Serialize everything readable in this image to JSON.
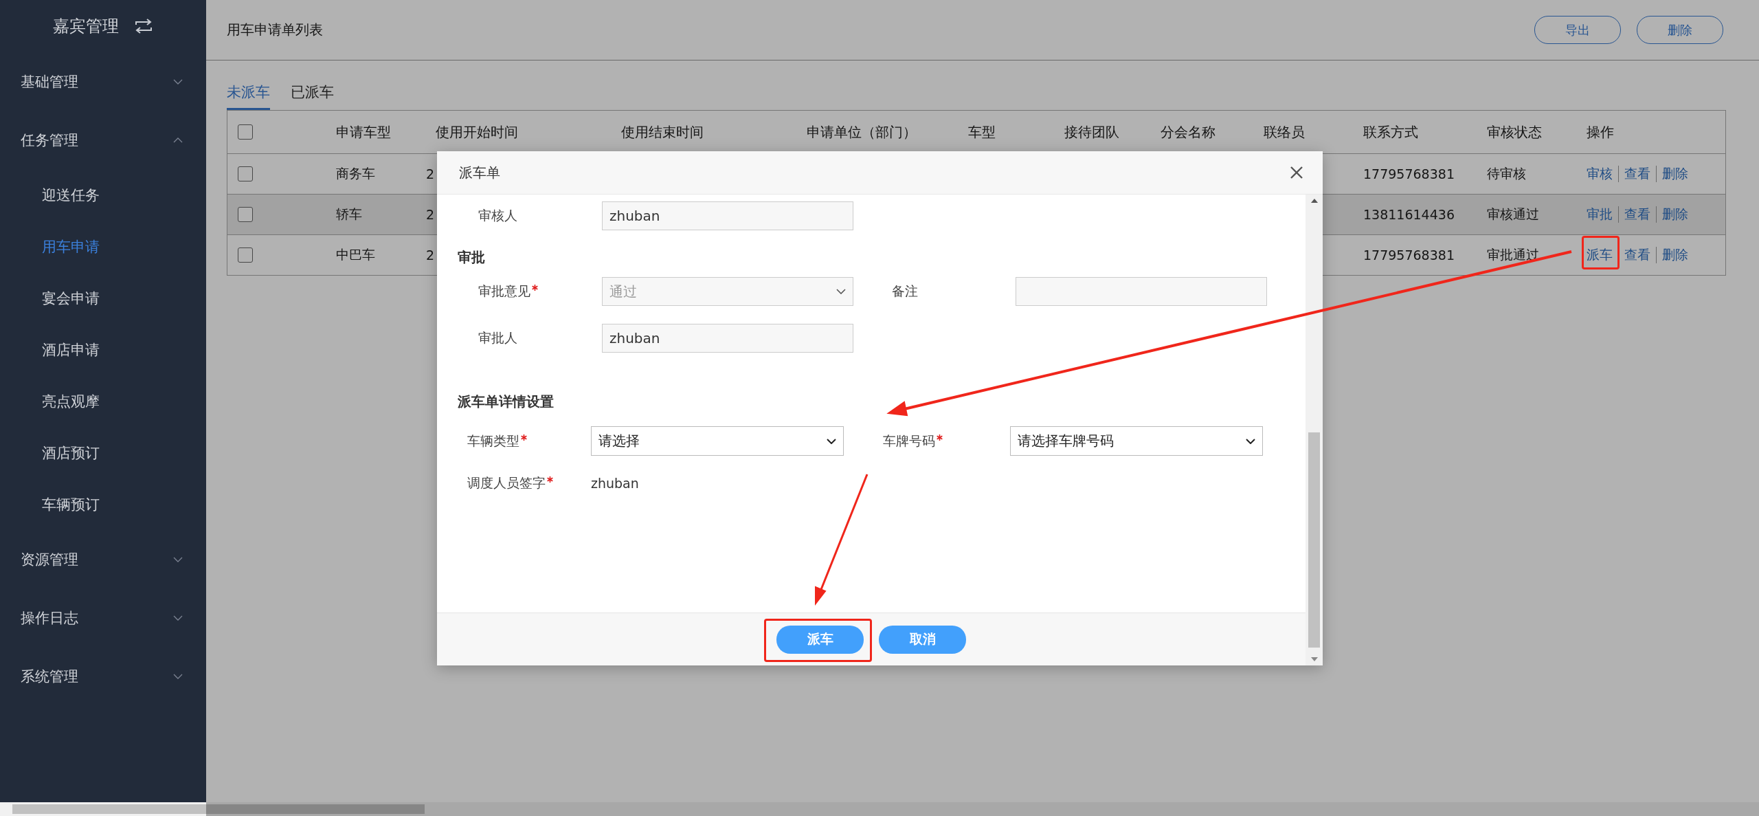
{
  "sidebar": {
    "title": "嘉宾管理",
    "groups": [
      {
        "label": "基础管理",
        "expanded": false
      },
      {
        "label": "任务管理",
        "expanded": true,
        "children": [
          {
            "label": "迎送任务",
            "selected": false
          },
          {
            "label": "用车申请",
            "selected": true
          },
          {
            "label": "宴会申请",
            "selected": false
          },
          {
            "label": "酒店申请",
            "selected": false
          },
          {
            "label": "亮点观摩",
            "selected": false
          },
          {
            "label": "酒店预订",
            "selected": false
          },
          {
            "label": "车辆预订",
            "selected": false
          }
        ]
      },
      {
        "label": "资源管理",
        "expanded": false
      },
      {
        "label": "操作日志",
        "expanded": false
      },
      {
        "label": "系统管理",
        "expanded": false
      }
    ]
  },
  "page": {
    "title": "用车申请单列表",
    "buttons": [
      "导出",
      "删除"
    ]
  },
  "tabs": [
    {
      "label": "未派车",
      "selected": true
    },
    {
      "label": "已派车",
      "selected": false
    }
  ],
  "table": {
    "all_checked": false,
    "columns": [
      "申请车型",
      "使用开始时间",
      "使用结束时间",
      "申请单位（部门）",
      "车型",
      "接待团队",
      "分会名称",
      "联络员",
      "联系方式",
      "审核状态",
      "操作"
    ],
    "rows": [
      {
        "checked": false,
        "highlighted": false,
        "car_type": "商务车",
        "start_time": "2",
        "phone": "17795768381",
        "status": "待审核",
        "actions": [
          "审核",
          "查看",
          "删除"
        ]
      },
      {
        "checked": false,
        "highlighted": true,
        "car_type": "轿车",
        "start_time": "2",
        "phone": "13811614436",
        "status": "审核通过",
        "actions": [
          "审批",
          "查看",
          "删除"
        ]
      },
      {
        "checked": false,
        "highlighted": false,
        "car_type": "中巴车",
        "start_time": "2",
        "phone": "17795768381",
        "status": "审批通过",
        "actions": [
          "派车",
          "查看",
          "删除"
        ]
      }
    ]
  },
  "dialog": {
    "title": "派车单",
    "reviewer": {
      "label": "审核人",
      "value": "zhuban"
    },
    "approval": {
      "heading": "审批",
      "opinion": {
        "label": "审批意见",
        "required": true,
        "disabled": true,
        "value": "通过"
      },
      "remark": {
        "label": "备注"
      },
      "approver": {
        "label": "审批人",
        "value": "zhuban"
      }
    },
    "dispatch": {
      "heading": "派车单详情设置",
      "vehicle_type": {
        "label": "车辆类型",
        "required": true,
        "placeholder": "请选择"
      },
      "plate": {
        "label": "车牌号码",
        "required": true,
        "placeholder": "请选择车牌号码"
      },
      "dispatcher": {
        "label": "调度人员签字",
        "required": true,
        "value": "zhuban"
      }
    },
    "buttons": [
      "派车",
      "取消"
    ]
  }
}
